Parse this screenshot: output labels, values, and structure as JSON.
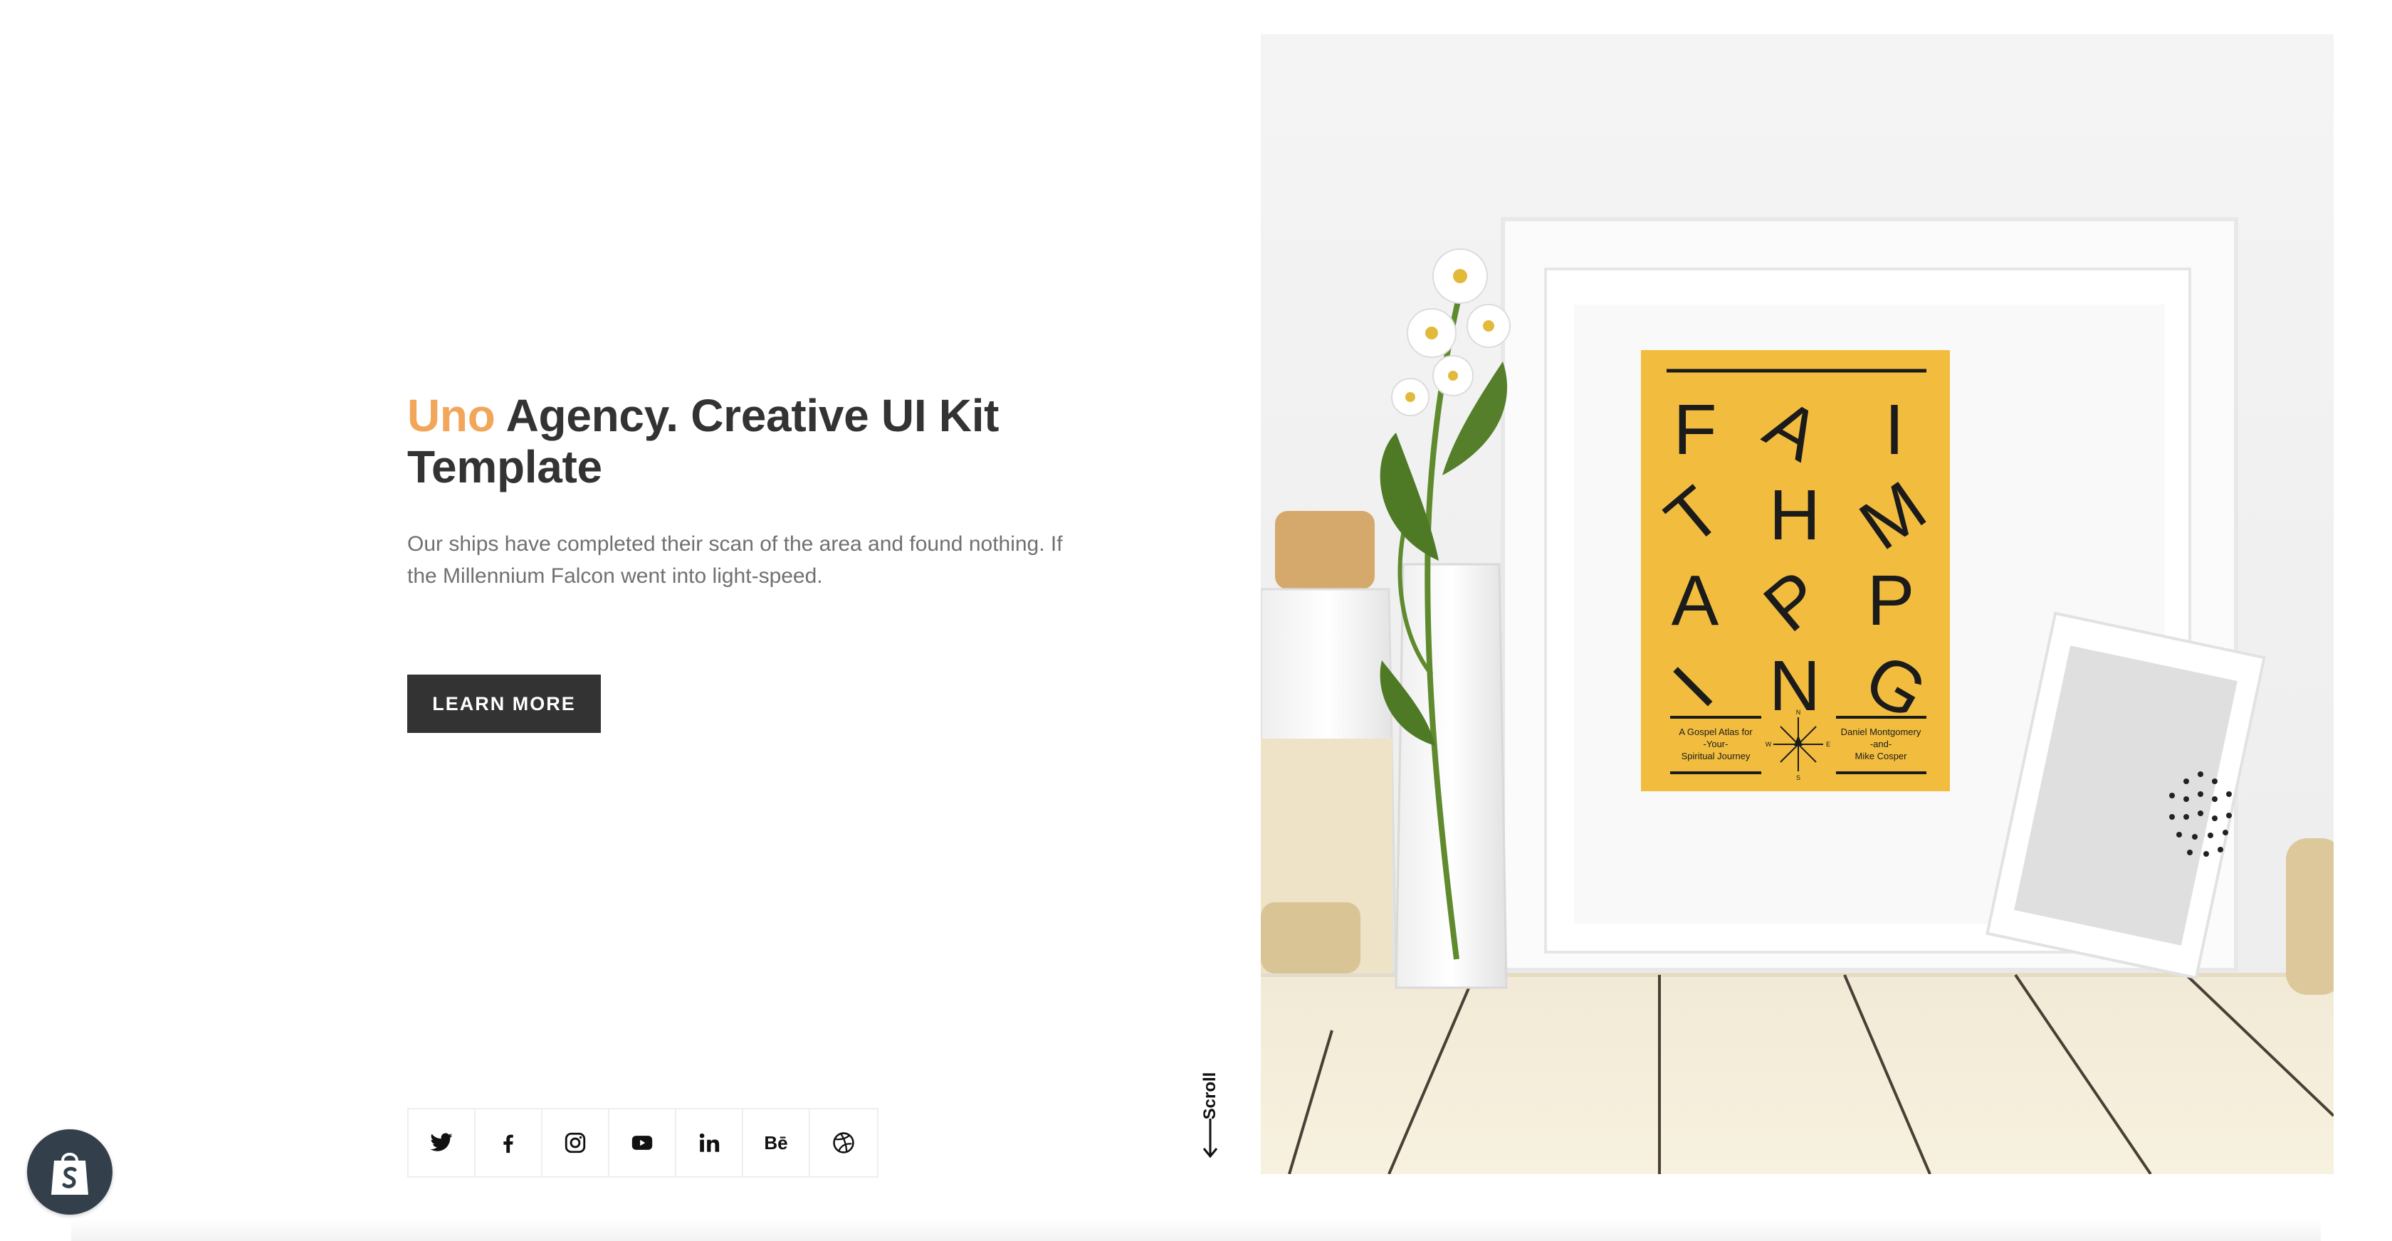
{
  "hero": {
    "title_accent": "Uno",
    "title_rest": " Agency. Creative UI Kit Template",
    "description": "Our ships have completed their scan of the area and found nothing. If the Millennium Falcon went into light-speed.",
    "cta_label": "LEARN MORE"
  },
  "social": [
    {
      "name": "twitter-icon"
    },
    {
      "name": "facebook-icon"
    },
    {
      "name": "instagram-icon"
    },
    {
      "name": "youtube-icon"
    },
    {
      "name": "linkedin-icon"
    },
    {
      "name": "behance-icon",
      "label": "Bē"
    },
    {
      "name": "dribbble-icon"
    }
  ],
  "scroll": {
    "label": "Scroll"
  },
  "poster": {
    "letters": [
      "F",
      "A",
      "I",
      "T",
      "H",
      "M",
      "A",
      "P",
      "P",
      "I",
      "N",
      "G"
    ],
    "caption_left": [
      "A Gospel Atlas for",
      "-Your-",
      "Spiritual Journey"
    ],
    "caption_right": [
      "Daniel Montgomery",
      "-and-",
      "Mike Cosper"
    ],
    "compass": {
      "n": "N",
      "s": "S",
      "e": "E",
      "w": "W"
    }
  },
  "colors": {
    "accent": "#f2a65a",
    "dark": "#333333",
    "text_muted": "#707070",
    "poster_yellow": "#f2bd3f",
    "shopify_badge": "#33404b"
  }
}
